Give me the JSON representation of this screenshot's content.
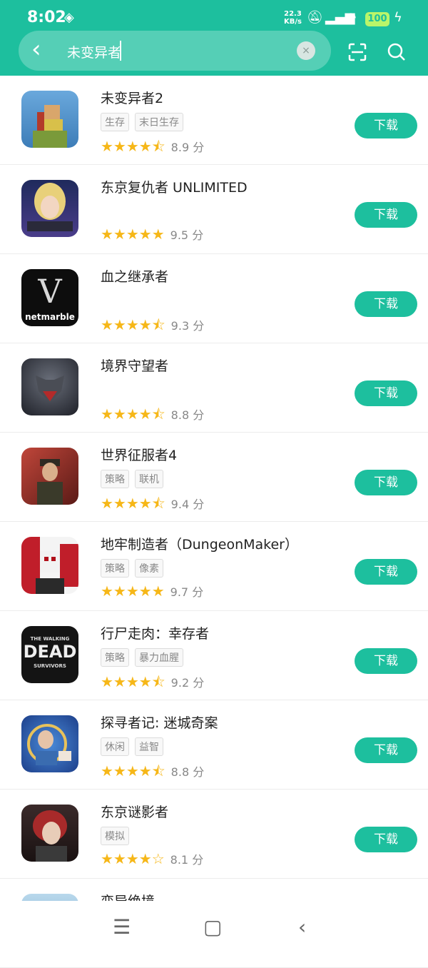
{
  "status": {
    "time": "8:02",
    "net_speed_top": "22.3",
    "net_speed_bottom": "KB/s",
    "battery": "100"
  },
  "search": {
    "query": "未变异者",
    "clear_label": "×"
  },
  "apps": [
    {
      "name": "未变异者2",
      "tags": [
        "生存",
        "末日生存"
      ],
      "stars": "★★★★⯪",
      "score": "8.9 分",
      "button": "下载",
      "icon_color": "#4a90c8"
    },
    {
      "name": "东京复仇者 UNLIMITED",
      "tags": [],
      "stars": "★★★★★",
      "score": "9.5 分",
      "button": "下载",
      "icon_color": "#2a2f6a"
    },
    {
      "name": "血之继承者",
      "tags": [],
      "stars": "★★★★⯪",
      "score": "9.3 分",
      "button": "下载",
      "icon_color": "#0d0d0d"
    },
    {
      "name": "境界守望者",
      "tags": [],
      "stars": "★★★★⯪",
      "score": "8.8 分",
      "button": "下载",
      "icon_color": "#3b3f4a"
    },
    {
      "name": "世界征服者4",
      "tags": [
        "策略",
        "联机"
      ],
      "stars": "★★★★⯪",
      "score": "9.4 分",
      "button": "下载",
      "icon_color": "#8a2a22"
    },
    {
      "name": "地牢制造者（DungeonMaker）",
      "tags": [
        "策略",
        "像素"
      ],
      "stars": "★★★★★",
      "score": "9.7 分",
      "button": "下载",
      "icon_color": "#c01e2a"
    },
    {
      "name": "行尸走肉：幸存者",
      "tags": [
        "策略",
        "暴力血腥"
      ],
      "stars": "★★★★⯪",
      "score": "9.2 分",
      "button": "下载",
      "icon_color": "#1a1a1a"
    },
    {
      "name": "探寻者记: 迷城奇案",
      "tags": [
        "休闲",
        "益智"
      ],
      "stars": "★★★★⯪",
      "score": "8.8 分",
      "button": "下载",
      "icon_color": "#2b5fb0"
    },
    {
      "name": "东京谜影者",
      "tags": [
        "模拟"
      ],
      "stars": "★★★★☆",
      "score": "8.1 分",
      "button": "下载",
      "icon_color": "#5a1e1e"
    },
    {
      "name": "变异绝境",
      "tags": [],
      "stars": "",
      "score": "",
      "button": "",
      "icon_color": "#9cc7e0"
    }
  ],
  "icon_labels": {
    "v": "V",
    "netmarble": "netmarble",
    "dead_top": "THE WALKING",
    "dead_main": "DEAD",
    "dead_bottom": "SURVIVORS"
  }
}
